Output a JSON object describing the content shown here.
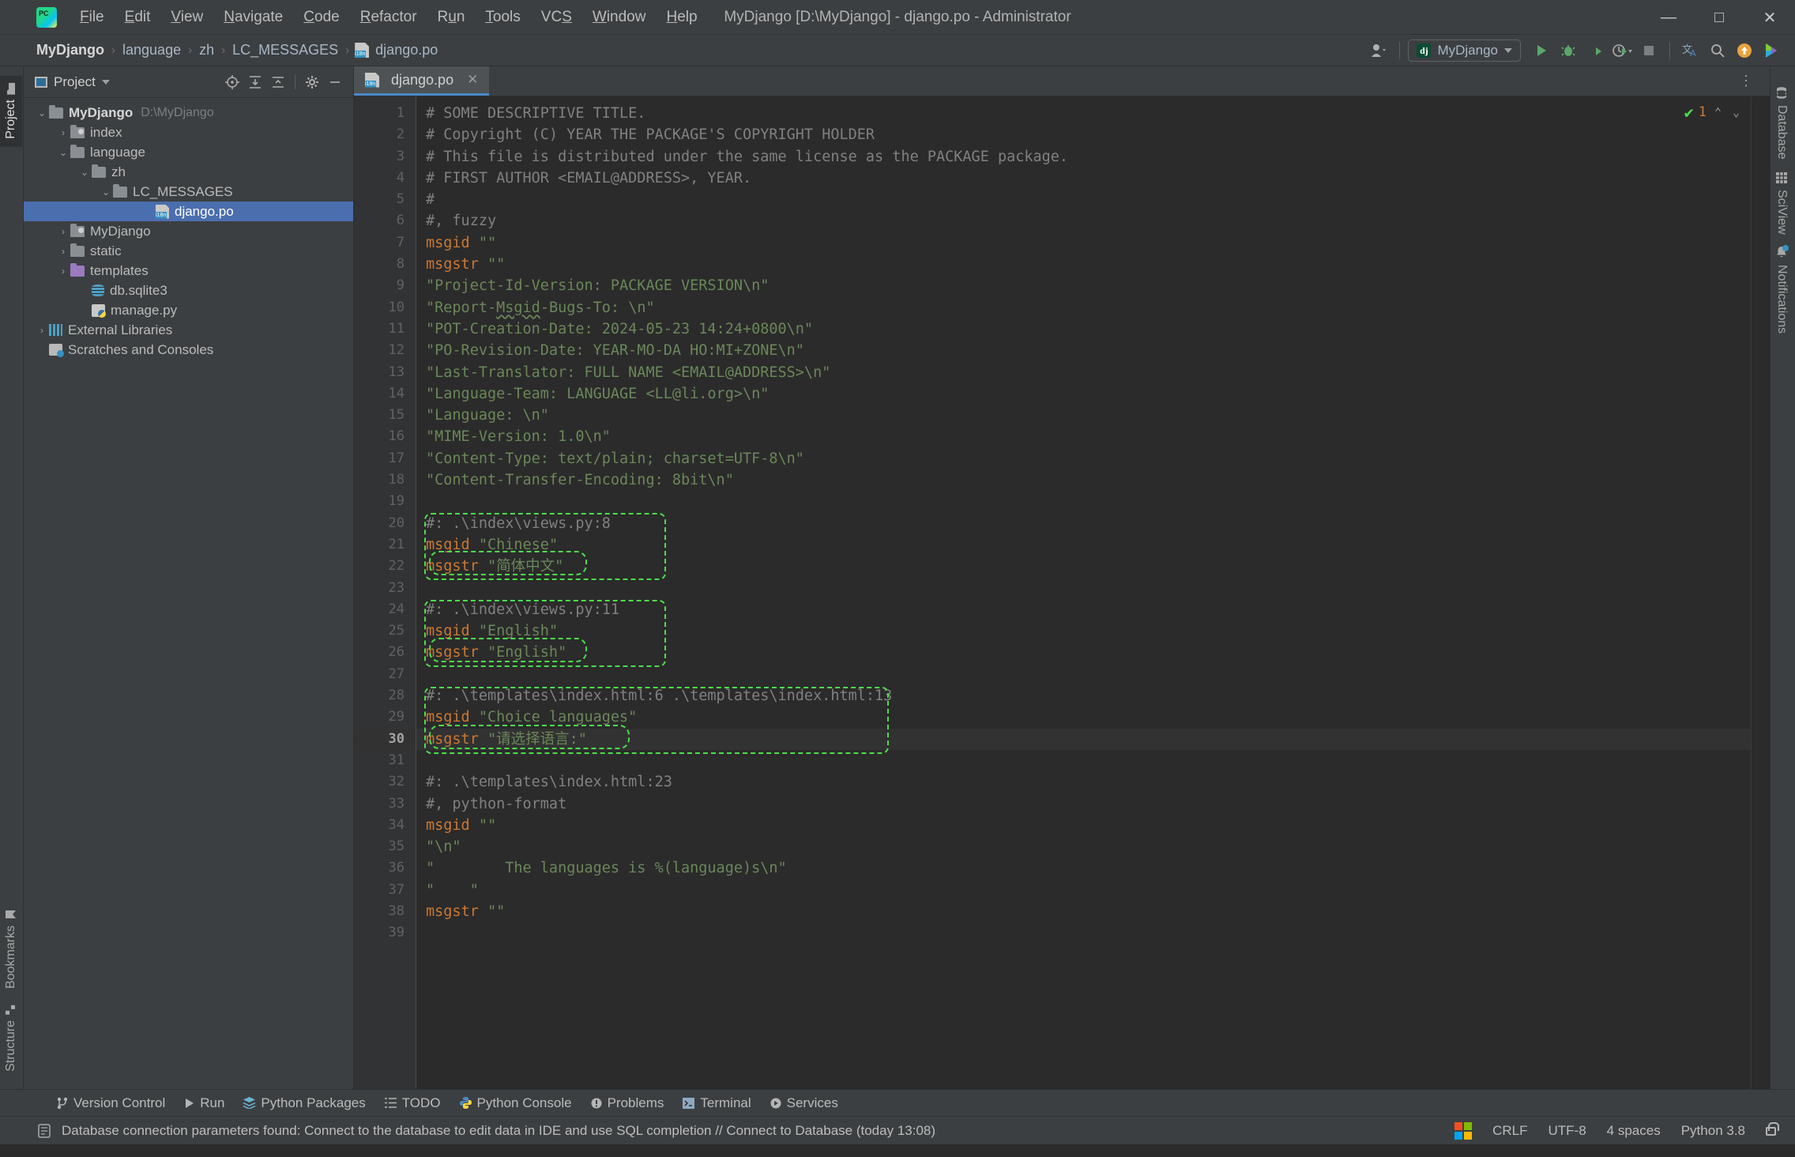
{
  "window": {
    "title": "MyDjango [D:\\MyDjango] - django.po - Administrator",
    "minimize": "—",
    "maximize": "□",
    "close": "✕"
  },
  "menubar": {
    "items": [
      {
        "label": "File"
      },
      {
        "label": "Edit"
      },
      {
        "label": "View"
      },
      {
        "label": "Navigate"
      },
      {
        "label": "Code"
      },
      {
        "label": "Refactor"
      },
      {
        "label": "Run"
      },
      {
        "label": "Tools"
      },
      {
        "label": "VCS"
      },
      {
        "label": "Window"
      },
      {
        "label": "Help"
      }
    ]
  },
  "breadcrumb": {
    "items": [
      "MyDjango",
      "language",
      "zh",
      "LC_MESSAGES",
      "django.po"
    ],
    "separator": "›"
  },
  "toolbar": {
    "run_config": "MyDjango",
    "run_config_icon": "django-icon",
    "buttons": [
      {
        "name": "profile-icon",
        "label": ""
      },
      {
        "name": "run-button",
        "label": "▶"
      },
      {
        "name": "debug-button",
        "label": ""
      },
      {
        "name": "coverage-button",
        "label": ""
      },
      {
        "name": "profiler-button",
        "label": ""
      },
      {
        "name": "stop-button",
        "label": "■"
      },
      {
        "name": "translate-icon",
        "label": ""
      },
      {
        "name": "search-everywhere-icon",
        "label": ""
      },
      {
        "name": "update-icon",
        "label": ""
      },
      {
        "name": "feature-trainer-icon",
        "label": ""
      }
    ]
  },
  "project_panel": {
    "title": "Project",
    "header_buttons": [
      "locate-icon",
      "expand-all-icon",
      "collapse-all-icon",
      "gear-icon",
      "hide-icon"
    ],
    "tree": [
      {
        "label": "MyDjango",
        "path": "D:\\MyDjango",
        "indent": 0,
        "arrow": "expanded",
        "icon": "folder",
        "bold": true,
        "selected": false
      },
      {
        "label": "index",
        "path": "",
        "indent": 1,
        "arrow": "collapsed",
        "icon": "module-folder",
        "bold": false,
        "selected": false
      },
      {
        "label": "language",
        "path": "",
        "indent": 1,
        "arrow": "expanded",
        "icon": "folder",
        "bold": false,
        "selected": false
      },
      {
        "label": "zh",
        "path": "",
        "indent": 2,
        "arrow": "expanded",
        "icon": "folder",
        "bold": false,
        "selected": false
      },
      {
        "label": "LC_MESSAGES",
        "path": "",
        "indent": 3,
        "arrow": "expanded",
        "icon": "folder",
        "bold": false,
        "selected": false
      },
      {
        "label": "django.po",
        "path": "",
        "indent": 5,
        "arrow": "none",
        "icon": "po-file",
        "bold": false,
        "selected": true
      },
      {
        "label": "MyDjango",
        "path": "",
        "indent": 1,
        "arrow": "collapsed",
        "icon": "module-folder",
        "bold": false,
        "selected": false
      },
      {
        "label": "static",
        "path": "",
        "indent": 1,
        "arrow": "collapsed",
        "icon": "folder",
        "bold": false,
        "selected": false
      },
      {
        "label": "templates",
        "path": "",
        "indent": 1,
        "arrow": "collapsed",
        "icon": "purple-folder",
        "bold": false,
        "selected": false
      },
      {
        "label": "db.sqlite3",
        "path": "",
        "indent": 2,
        "arrow": "none",
        "icon": "database-file",
        "bold": false,
        "selected": false
      },
      {
        "label": "manage.py",
        "path": "",
        "indent": 2,
        "arrow": "none",
        "icon": "python-file",
        "bold": false,
        "selected": false
      },
      {
        "label": "External Libraries",
        "path": "",
        "indent": 0,
        "arrow": "collapsed",
        "icon": "library",
        "bold": false,
        "selected": false
      },
      {
        "label": "Scratches and Consoles",
        "path": "",
        "indent": 0,
        "arrow": "none",
        "icon": "scratch",
        "bold": false,
        "selected": false
      }
    ]
  },
  "left_stripe": {
    "top": [
      {
        "label": "Project",
        "icon": "folder-icon",
        "active": true
      }
    ],
    "bottom": [
      {
        "label": "Bookmarks",
        "icon": "bookmark-icon",
        "active": false
      },
      {
        "label": "Structure",
        "icon": "structure-icon",
        "active": false
      }
    ]
  },
  "right_stripe": {
    "items": [
      {
        "label": "Database",
        "icon": "database-icon"
      },
      {
        "label": "SciView",
        "icon": "grid-icon"
      },
      {
        "label": "Notifications",
        "icon": "bell-icon"
      }
    ]
  },
  "editor": {
    "tab": {
      "label": "django.po",
      "icon": "po-file-icon",
      "close": "✕"
    },
    "inspection": {
      "status_icon": "green-check",
      "warning_count": "1",
      "up": "⌃",
      "down": "⌄"
    },
    "current_line": 30,
    "lines": [
      {
        "n": 1,
        "tokens": [
          {
            "c": "cmt",
            "t": "# SOME DESCRIPTIVE TITLE."
          }
        ]
      },
      {
        "n": 2,
        "tokens": [
          {
            "c": "cmt",
            "t": "# Copyright (C) YEAR THE PACKAGE'S COPYRIGHT HOLDER"
          }
        ]
      },
      {
        "n": 3,
        "tokens": [
          {
            "c": "cmt",
            "t": "# This file is distributed under the same license as the PACKAGE package."
          }
        ]
      },
      {
        "n": 4,
        "tokens": [
          {
            "c": "cmt",
            "t": "# FIRST AUTHOR <EMAIL@ADDRESS>, YEAR."
          }
        ]
      },
      {
        "n": 5,
        "tokens": [
          {
            "c": "cmt",
            "t": "#"
          }
        ]
      },
      {
        "n": 6,
        "tokens": [
          {
            "c": "cmt",
            "t": "#, fuzzy"
          }
        ]
      },
      {
        "n": 7,
        "tokens": [
          {
            "c": "kw",
            "t": "msgid"
          },
          {
            "c": "str",
            "t": " \"\""
          }
        ]
      },
      {
        "n": 8,
        "tokens": [
          {
            "c": "kw",
            "t": "msgstr"
          },
          {
            "c": "str",
            "t": " \"\""
          }
        ]
      },
      {
        "n": 9,
        "tokens": [
          {
            "c": "str",
            "t": "\"Project-Id-Version: PACKAGE VERSION\\n\""
          }
        ]
      },
      {
        "n": 10,
        "tokens": [
          {
            "c": "str",
            "t": "\"Report-"
          },
          {
            "c": "str wavy",
            "t": "Msgid"
          },
          {
            "c": "str",
            "t": "-Bugs-To: \\n\""
          }
        ]
      },
      {
        "n": 11,
        "tokens": [
          {
            "c": "str",
            "t": "\"POT-Creation-Date: 2024-05-23 14:24+0800\\n\""
          }
        ]
      },
      {
        "n": 12,
        "tokens": [
          {
            "c": "str",
            "t": "\"PO-Revision-Date: YEAR-MO-DA HO:MI+ZONE\\n\""
          }
        ]
      },
      {
        "n": 13,
        "tokens": [
          {
            "c": "str",
            "t": "\"Last-Translator: FULL NAME <EMAIL@ADDRESS>\\n\""
          }
        ]
      },
      {
        "n": 14,
        "tokens": [
          {
            "c": "str",
            "t": "\"Language-Team: LANGUAGE <LL@li.org>\\n\""
          }
        ]
      },
      {
        "n": 15,
        "tokens": [
          {
            "c": "str",
            "t": "\"Language: \\n\""
          }
        ]
      },
      {
        "n": 16,
        "tokens": [
          {
            "c": "str",
            "t": "\"MIME-Version: 1.0\\n\""
          }
        ]
      },
      {
        "n": 17,
        "tokens": [
          {
            "c": "str",
            "t": "\"Content-Type: text/plain; charset=UTF-8\\n\""
          }
        ]
      },
      {
        "n": 18,
        "tokens": [
          {
            "c": "str",
            "t": "\"Content-Transfer-Encoding: 8bit\\n\""
          }
        ]
      },
      {
        "n": 19,
        "tokens": []
      },
      {
        "n": 20,
        "tokens": [
          {
            "c": "cmt",
            "t": "#: .\\index\\views.py:8"
          }
        ]
      },
      {
        "n": 21,
        "tokens": [
          {
            "c": "kw",
            "t": "msgid"
          },
          {
            "c": "str",
            "t": " \"Chinese\""
          }
        ]
      },
      {
        "n": 22,
        "tokens": [
          {
            "c": "kw",
            "t": "msgstr"
          },
          {
            "c": "str",
            "t": " \"简体中文\""
          }
        ]
      },
      {
        "n": 23,
        "tokens": []
      },
      {
        "n": 24,
        "tokens": [
          {
            "c": "cmt",
            "t": "#: .\\index\\views.py:11"
          }
        ]
      },
      {
        "n": 25,
        "tokens": [
          {
            "c": "kw",
            "t": "msgid"
          },
          {
            "c": "str",
            "t": " \"English\""
          }
        ]
      },
      {
        "n": 26,
        "tokens": [
          {
            "c": "kw",
            "t": "msgstr"
          },
          {
            "c": "str",
            "t": " \"English\""
          }
        ]
      },
      {
        "n": 27,
        "tokens": []
      },
      {
        "n": 28,
        "tokens": [
          {
            "c": "cmt",
            "t": "#: .\\templates\\index.html:6 .\\templates\\index.html:13"
          }
        ]
      },
      {
        "n": 29,
        "tokens": [
          {
            "c": "kw",
            "t": "msgid"
          },
          {
            "c": "str",
            "t": " \"Choice languages\""
          }
        ]
      },
      {
        "n": 30,
        "tokens": [
          {
            "c": "kw",
            "t": "msgstr"
          },
          {
            "c": "str",
            "t": " \"请选择语言:\""
          }
        ]
      },
      {
        "n": 31,
        "tokens": []
      },
      {
        "n": 32,
        "tokens": [
          {
            "c": "cmt",
            "t": "#: .\\templates\\index.html:23"
          }
        ]
      },
      {
        "n": 33,
        "tokens": [
          {
            "c": "cmt",
            "t": "#, python-format"
          }
        ]
      },
      {
        "n": 34,
        "tokens": [
          {
            "c": "kw",
            "t": "msgid"
          },
          {
            "c": "str",
            "t": " \"\""
          }
        ]
      },
      {
        "n": 35,
        "tokens": [
          {
            "c": "str",
            "t": "\"\\n\""
          }
        ]
      },
      {
        "n": 36,
        "tokens": [
          {
            "c": "str",
            "t": "\"        The languages is %(language)s\\n\""
          }
        ]
      },
      {
        "n": 37,
        "tokens": [
          {
            "c": "str",
            "t": "\"    \""
          }
        ]
      },
      {
        "n": 38,
        "tokens": [
          {
            "c": "kw",
            "t": "msgstr"
          },
          {
            "c": "str",
            "t": " \"\""
          }
        ]
      },
      {
        "n": 39,
        "tokens": []
      }
    ]
  },
  "toolwindow_bar": {
    "items": [
      {
        "label": "Version Control",
        "icon": "branch-icon"
      },
      {
        "label": "Run",
        "icon": "play-icon"
      },
      {
        "label": "Python Packages",
        "icon": "packages-icon"
      },
      {
        "label": "TODO",
        "icon": "todo-icon"
      },
      {
        "label": "Python Console",
        "icon": "python-icon"
      },
      {
        "label": "Problems",
        "icon": "problems-icon"
      },
      {
        "label": "Terminal",
        "icon": "terminal-icon"
      },
      {
        "label": "Services",
        "icon": "services-icon"
      }
    ]
  },
  "statusbar": {
    "message": "Database connection parameters found: Connect to the database to edit data in IDE and use SQL completion // Connect to Database (today 13:08)",
    "message_icon": "database-notice-icon",
    "line_separator": "CRLF",
    "encoding": "UTF-8",
    "indent": "4 spaces",
    "interpreter": "Python 3.8",
    "lock_icon": "unlocked-icon",
    "os_icon": "windows-logo"
  },
  "colors": {
    "accent": "#4b6eaf",
    "highlight_green": "#4ddd4d",
    "keyword": "#cc7832",
    "string": "#6a8759",
    "comment": "#808080",
    "chrome": "#3c3f41",
    "editor_bg": "#2b2b2b"
  }
}
